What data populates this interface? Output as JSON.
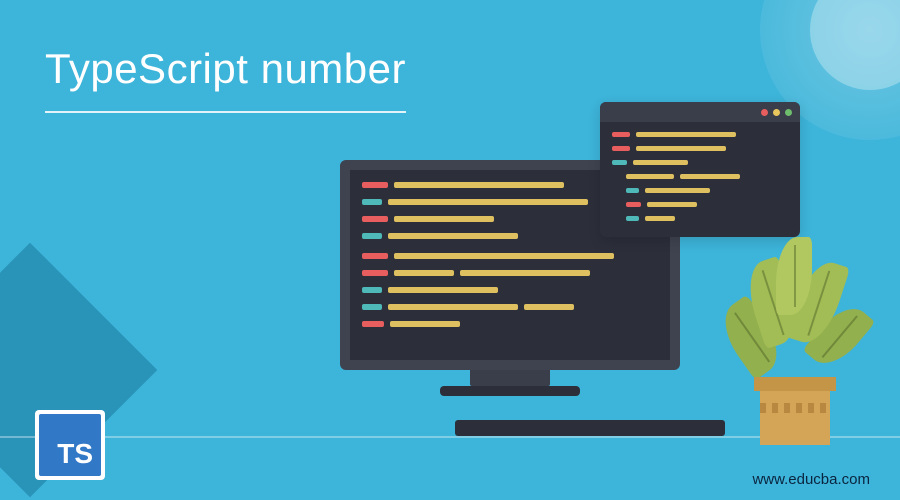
{
  "header": {
    "title": "TypeScript number"
  },
  "logo": {
    "text": "TS"
  },
  "footer": {
    "url": "www.educba.com"
  },
  "window_dots": [
    "red",
    "yellow",
    "green"
  ]
}
